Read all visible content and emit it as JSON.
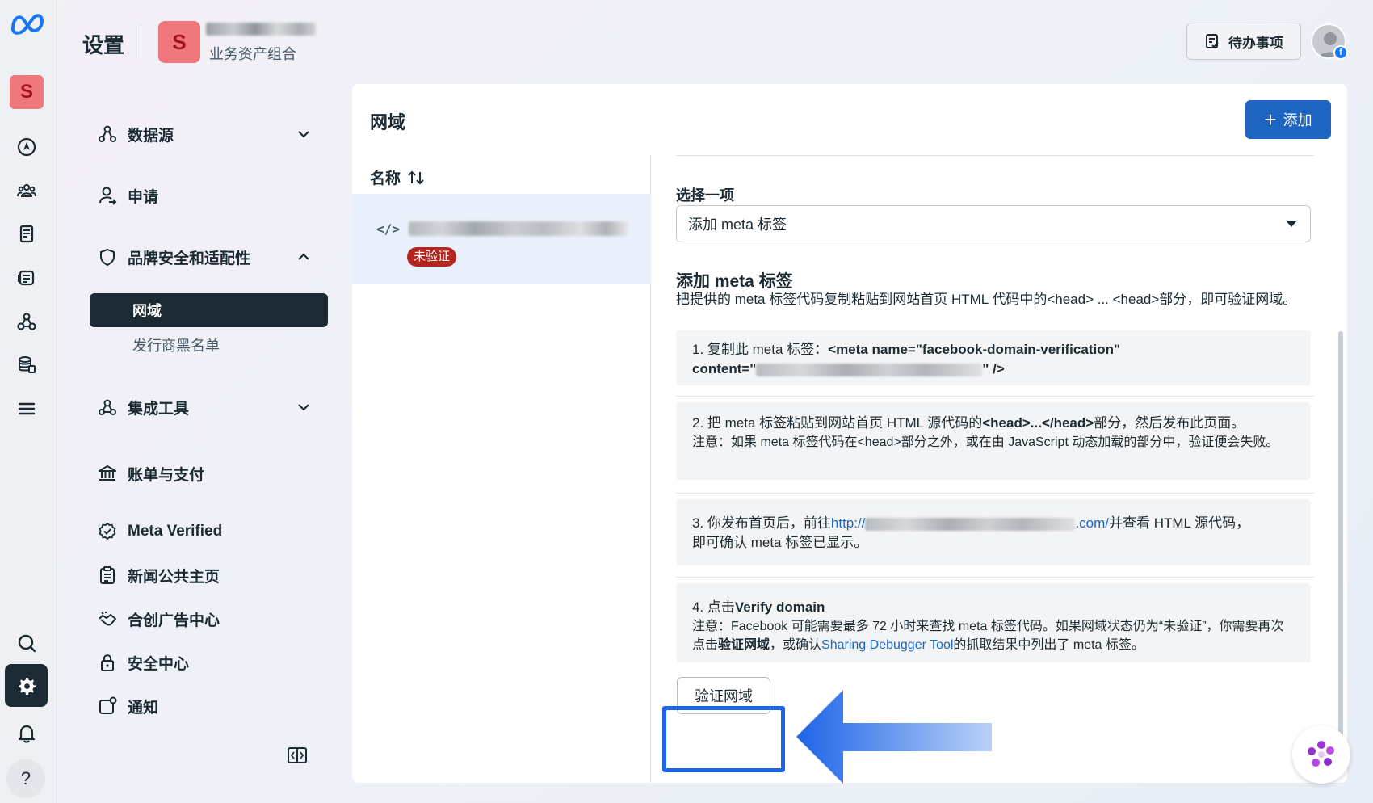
{
  "header": {
    "title": "设置",
    "business_initial": "S",
    "business_sub": "业务资产组合",
    "todo_label": "待办事项"
  },
  "rail": {
    "initial": "S",
    "help": "?"
  },
  "nav": {
    "items": [
      {
        "label": "数据源",
        "icon": "data-source-icon"
      },
      {
        "label": "申请",
        "icon": "person-icon"
      },
      {
        "label": "品牌安全和适配性",
        "icon": "shield-icon"
      },
      {
        "label": "集成工具",
        "icon": "integrations-icon"
      },
      {
        "label": "账单与支付",
        "icon": "bank-icon"
      },
      {
        "label": "Meta Verified",
        "icon": "verified-badge-icon"
      },
      {
        "label": "新闻公共主页",
        "icon": "news-icon"
      },
      {
        "label": "合创广告中心",
        "icon": "handshake-icon"
      },
      {
        "label": "安全中心",
        "icon": "lock-icon"
      },
      {
        "label": "通知",
        "icon": "notification-icon"
      }
    ],
    "sub_items": [
      {
        "label": "网域",
        "active": true
      },
      {
        "label": "发行商黑名单",
        "active": false
      }
    ]
  },
  "panel": {
    "title": "网域",
    "add_label": "添加",
    "list_header": "名称",
    "sort_icon": "sort-icon",
    "row_badge": "未验证"
  },
  "detail": {
    "select_label": "选择一项",
    "select_value": "添加 meta 标签",
    "section_title": "添加 meta 标签",
    "section_desc": "把提供的 meta 标签代码复制粘贴到网站首页 HTML 代码中的<head> ... <head>部分，即可验证网域。",
    "step1_prefix": "1. 复制此 meta 标签：",
    "step1_code": "<meta name=\"facebook-domain-verification\"",
    "step1_code2_prefix": "content=\"",
    "step1_code2_suffix": "\" />",
    "step2_prefix": "2. 把 meta 标签粘贴到网站首页 HTML 源代码的",
    "step2_code": "<head>...</head>",
    "step2_suffix": "部分，然后发布此页面。",
    "step2_note": "注意：如果 meta 标签代码在<head>部分之外，或在由 JavaScript 动态加载的部分中，验证便会失败。",
    "step3_prefix": "3. 你发布首页后，前往",
    "step3_link_a": "http://",
    "step3_link_b": ".com/",
    "step3_suffix": "并查看 HTML 源代码，",
    "step3_line2": "即可确认 meta 标签已显示。",
    "step4_prefix": "4. 点击",
    "step4_bold": "Verify domain",
    "step4_note_a": "注意：Facebook 可能需要最多 72 小时来查找 meta 标签代码。如果网域状态仍为“未验证”，你需要再次点击",
    "step4_note_bold": "验证网域",
    "step4_note_b": "，或确认",
    "step4_link": "Sharing Debugger Tool",
    "step4_note_c": "的抓取结果中列出了 meta 标签。",
    "verify_label": "验证网域"
  },
  "colors": {
    "accent": "#1d65c1",
    "badge": "#b3261e",
    "nav_active": "#1c2b33",
    "highlight": "#1d65e8"
  }
}
